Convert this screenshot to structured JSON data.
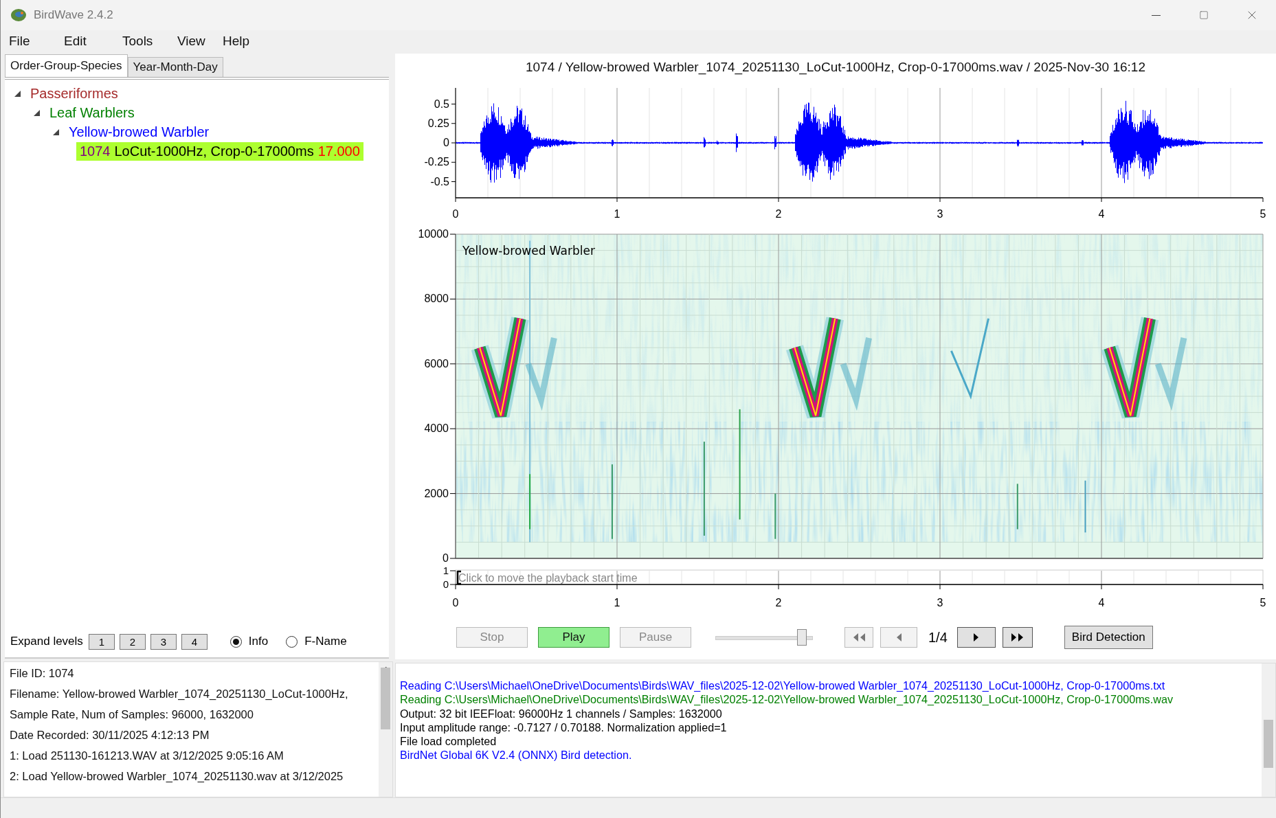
{
  "window": {
    "title": "BirdWave 2.4.2"
  },
  "menu": [
    "File",
    "Edit",
    "Tools",
    "View",
    "Help"
  ],
  "left_panel": {
    "tabs": [
      {
        "label": "Order-Group-Species",
        "selected": true
      },
      {
        "label": "Year-Month-Day",
        "selected": false
      }
    ],
    "tree": [
      {
        "kind": "group",
        "label": "Passeriformes",
        "color": "#a52a2a",
        "expanded": true,
        "children": [
          {
            "kind": "group",
            "label": "Leaf Warblers",
            "color": "#008000",
            "expanded": true,
            "children": [
              {
                "kind": "group",
                "label": "Yellow-browed Warbler",
                "color": "#0000ff",
                "expanded": true,
                "children": [
                  {
                    "kind": "file",
                    "id": "1074",
                    "label": "LoCut-1000Hz, Crop-0-17000ms",
                    "duration": "17.000",
                    "selected": true
                  }
                ]
              }
            ]
          }
        ]
      }
    ],
    "expand_levels": {
      "label": "Expand levels",
      "buttons": [
        "1",
        "2",
        "3",
        "4"
      ]
    },
    "display_mode": [
      {
        "label": "Info",
        "selected": true
      },
      {
        "label": "F-Name",
        "selected": false
      }
    ],
    "info": [
      "File ID: 1074",
      "Filename: Yellow-browed Warbler_1074_20251130_LoCut-1000Hz,",
      "Sample Rate, Num of Samples: 96000, 1632000",
      "Date Recorded:  30/11/2025 4:12:13 PM",
      "1: Load 251130-161213.WAV at 3/12/2025 9:05:16 AM",
      "2: Load Yellow-browed Warbler_1074_20251130.wav at 3/12/2025"
    ]
  },
  "viewer": {
    "title": "1074 / Yellow-browed Warbler_1074_20251130_LoCut-1000Hz, Crop-0-17000ms.wav / 2025-Nov-30 16:12",
    "waveform": {
      "yticks": [
        "0.5",
        "0.25",
        "0",
        "-0.25",
        "-0.5"
      ],
      "xticks": [
        "0",
        "1",
        "2",
        "3",
        "4",
        "5"
      ]
    },
    "spectrogram": {
      "label": "Yellow-browed Warbler",
      "yticks": [
        "10000",
        "8000",
        "6000",
        "4000",
        "2000",
        "0"
      ]
    },
    "playback_strip": {
      "hint": "Click to move the playback start time",
      "yticks": [
        "1",
        "0"
      ],
      "xticks": [
        "0",
        "1",
        "2",
        "3",
        "4",
        "5"
      ]
    },
    "transport": [
      {
        "label": "Stop",
        "active": false,
        "disabled": true
      },
      {
        "label": "Play",
        "active": true,
        "disabled": false
      },
      {
        "label": "Pause",
        "active": false,
        "disabled": true
      }
    ],
    "volume": {
      "level": 0.93
    },
    "navigation": {
      "buttons": [
        {
          "kind": "first",
          "disabled": true
        },
        {
          "kind": "prev",
          "disabled": true
        },
        {
          "kind": "next",
          "disabled": false
        },
        {
          "kind": "last",
          "disabled": false
        }
      ],
      "counter": "1/4"
    },
    "detect_button": "Bird Detection"
  },
  "log": [
    {
      "text": "Reading C:\\Users\\Michael\\OneDrive\\Documents\\Birds\\WAV_files\\2025-12-02\\Yellow-browed Warbler_1074_20251130_LoCut-1000Hz, Crop-0-17000ms.txt",
      "color": "#0000ff"
    },
    {
      "text": "Reading C:\\Users\\Michael\\OneDrive\\Documents\\Birds\\WAV_files\\2025-12-02\\Yellow-browed Warbler_1074_20251130_LoCut-1000Hz, Crop-0-17000ms.wav",
      "color": "#008000"
    },
    {
      "text": "Output: 32 bit IEEFloat: 96000Hz 1 channels / Samples: 1632000",
      "color": "#000000"
    },
    {
      "text": "Input amplitude range: -0.7127 / 0.70188. Normalization applied=1",
      "color": "#000000"
    },
    {
      "text": "File load completed",
      "color": "#000000"
    },
    {
      "text": "BirdNet Global 6K V2.4 (ONNX) Bird detection.",
      "color": "#0000ff"
    }
  ]
}
